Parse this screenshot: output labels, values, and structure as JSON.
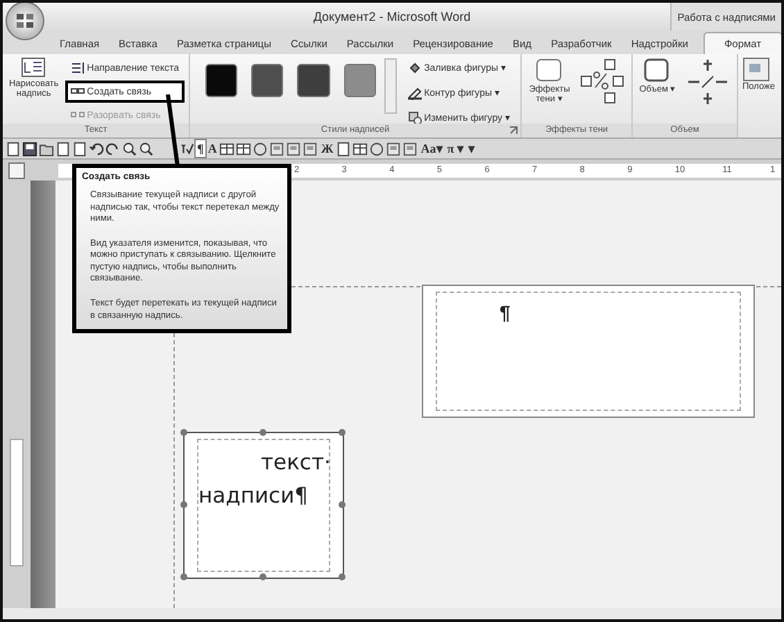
{
  "window": {
    "title": "Документ2 - Microsoft Word",
    "context_group": "Работа с надписями"
  },
  "tabs": [
    {
      "label": "Главная",
      "selected": false
    },
    {
      "label": "Вставка",
      "selected": false
    },
    {
      "label": "Разметка страницы",
      "selected": false
    },
    {
      "label": "Ссылки",
      "selected": false
    },
    {
      "label": "Рассылки",
      "selected": false
    },
    {
      "label": "Рецензирование",
      "selected": false
    },
    {
      "label": "Вид",
      "selected": false
    },
    {
      "label": "Разработчик",
      "selected": false
    },
    {
      "label": "Надстройки",
      "selected": false
    },
    {
      "label": "Формат",
      "selected": true
    }
  ],
  "ribbon": {
    "text_group": {
      "label": "Текст",
      "draw_button": "Нарисовать надпись",
      "commands": [
        {
          "kind": "direction",
          "label": "Направление текста",
          "disabled": false,
          "highlighted": false
        },
        {
          "kind": "link",
          "label": "Создать связь",
          "disabled": false,
          "highlighted": true
        },
        {
          "kind": "unlink",
          "label": "Разорвать связь",
          "disabled": true,
          "highlighted": false
        }
      ]
    },
    "styles_group": {
      "label": "Стили надписей",
      "swatches": [
        {
          "color": "#0a0a0a"
        },
        {
          "color": "#4e4e4e"
        },
        {
          "color": "#3e3e3e"
        },
        {
          "color": "#8c8c8c"
        }
      ],
      "commands": [
        {
          "kind": "fill",
          "label": "Заливка фигуры ▾"
        },
        {
          "kind": "outline",
          "label": "Контур фигуры ▾"
        },
        {
          "kind": "shape",
          "label": "Изменить фигуру ▾"
        }
      ]
    },
    "shadow_group": {
      "label": "Эффекты тени",
      "button": "Эффекты тени ▾"
    },
    "volume_group": {
      "label": "Объем",
      "button": "Объем ▾"
    },
    "position_group": {
      "button": "Положе"
    }
  },
  "quick_toolbar": [
    {
      "kind": "page"
    },
    {
      "kind": "save"
    },
    {
      "kind": "folder"
    },
    {
      "kind": "page"
    },
    {
      "kind": "page"
    },
    {
      "kind": "undo"
    },
    {
      "kind": "redo"
    },
    {
      "kind": "search"
    },
    {
      "kind": "search"
    },
    {
      "kind": "spell"
    },
    {
      "kind": "glyph",
      "text": "¶",
      "selected": true
    },
    {
      "kind": "glyph",
      "text": "A",
      "selected": false
    },
    {
      "kind": "table"
    },
    {
      "kind": "table"
    },
    {
      "kind": "circle"
    },
    {
      "kind": "frame"
    },
    {
      "kind": "frame"
    },
    {
      "kind": "frame"
    },
    {
      "kind": "glyph",
      "text": "Ж",
      "selected": false
    },
    {
      "kind": "page"
    },
    {
      "kind": "table"
    },
    {
      "kind": "circle"
    },
    {
      "kind": "frame"
    },
    {
      "kind": "frame"
    },
    {
      "kind": "glyph",
      "text": "Aa▾",
      "selected": false
    },
    {
      "kind": "glyph",
      "text": "π ▾",
      "selected": false
    },
    {
      "kind": "glyph",
      "text": "▾",
      "selected": false
    }
  ],
  "ruler": {
    "labels": [
      "2",
      "3",
      "4",
      "5",
      "6",
      "7",
      "8",
      "9",
      "10",
      "11",
      "1"
    ]
  },
  "tooltip": {
    "title": "Создать связь",
    "paragraphs": [
      "Связывание текущей надписи с другой надписью так, чтобы текст перетекал между ними.",
      "Вид указателя изменится, показывая, что можно приступать к связыванию. Щелкните пустую надпись, чтобы выполнить связывание.",
      "Текст будет перетекать из текущей надписи в связанную надпись."
    ]
  },
  "document": {
    "textboxes": [
      {
        "text": "¶",
        "selected": false
      },
      {
        "text": "текст· надписи¶",
        "selected": true
      }
    ]
  }
}
